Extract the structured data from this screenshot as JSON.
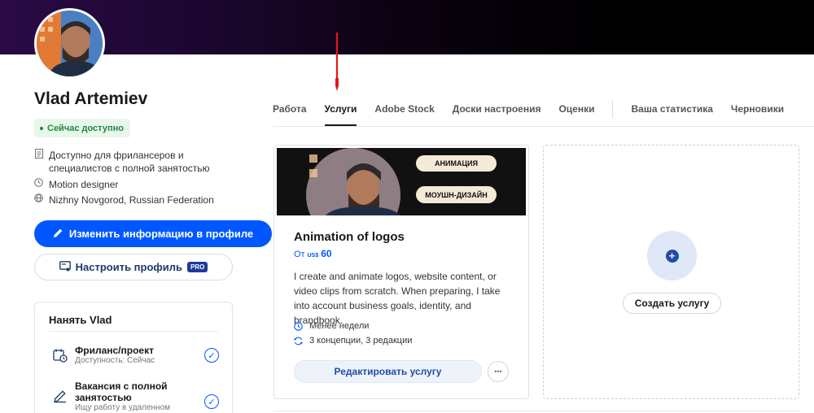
{
  "profile": {
    "name": "Vlad Artemiev",
    "status": "Сейчас доступно",
    "availability_line1": "Доступно для фрилансеров и",
    "availability_line2": "специалистов с полной занятостью",
    "role": "Motion designer",
    "location": "Nizhny Novgorod, Russian Federation",
    "edit_button": "Изменить информацию в профиле",
    "setup_button": "Настроить профиль",
    "pro_badge": "PRO"
  },
  "hire": {
    "title": "Нанять Vlad",
    "items": [
      {
        "title": "Фриланс/проект",
        "subtitle": "Доступность: Сейчас"
      },
      {
        "title_line1": "Вакансия с полной",
        "title_line2": "занятостью",
        "subtitle": "Ищу работу в удаленном"
      }
    ]
  },
  "tabs": [
    "Работа",
    "Услуги",
    "Adobe Stock",
    "Доски настроения",
    "Оценки",
    "Ваша статистика",
    "Черновики"
  ],
  "active_tab": "Услуги",
  "service": {
    "badge_top": "АНИМАЦИЯ",
    "badge_bottom": "МОУШН-ДИЗАЙН",
    "title": "Animation of logos",
    "price_prefix": "От",
    "currency": "US$",
    "price": "60",
    "description": "I create and animate logos, website content, or video clips from scratch. When preparing, I take into account business goals, identity, and brandbook.",
    "delivery": "Менее недели",
    "revisions": "3 концепции, 3 редакции",
    "edit_button": "Редактировать услугу",
    "more_icon": "ellipsis-icon"
  },
  "create": {
    "button": "Создать услугу",
    "icon": "plus-icon"
  },
  "colors": {
    "accent": "#0057ff",
    "status_green": "#1a8a3a",
    "annotation_arrow": "#e8141b"
  }
}
